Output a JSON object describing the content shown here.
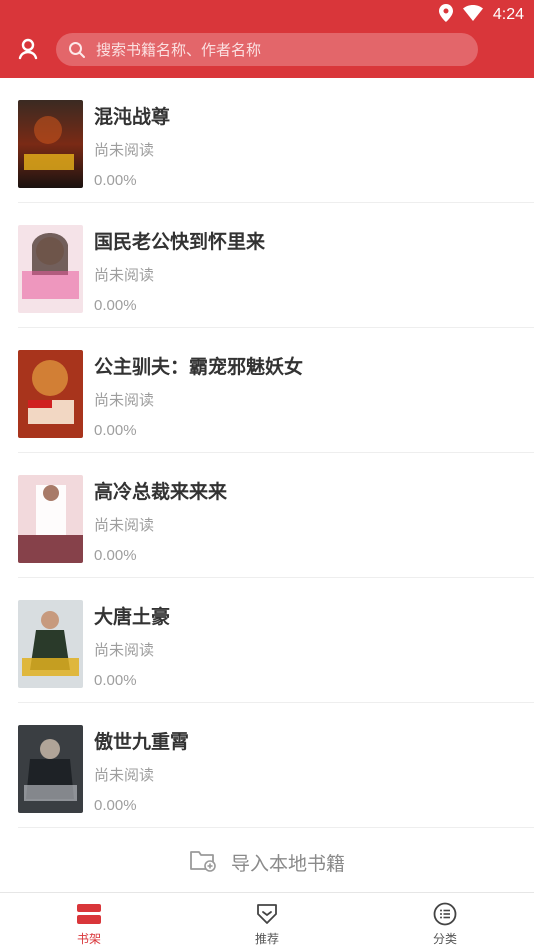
{
  "status_bar": {
    "time": "4:24"
  },
  "search": {
    "placeholder": "搜索书籍名称、作者名称"
  },
  "books": [
    {
      "title": "混沌战尊",
      "status": "尚未阅读",
      "progress": "0.00%"
    },
    {
      "title": "国民老公快到怀里来",
      "status": "尚未阅读",
      "progress": "0.00%"
    },
    {
      "title": "公主驯夫：霸宠邪魅妖女",
      "status": "尚未阅读",
      "progress": "0.00%"
    },
    {
      "title": "高冷总裁来来来",
      "status": "尚未阅读",
      "progress": "0.00%"
    },
    {
      "title": "大唐土豪",
      "status": "尚未阅读",
      "progress": "0.00%"
    },
    {
      "title": "傲世九重霄",
      "status": "尚未阅读",
      "progress": "0.00%"
    }
  ],
  "import": {
    "label": "导入本地书籍"
  },
  "tabs": [
    {
      "label": "书架",
      "icon": "bookshelf-icon",
      "active": true
    },
    {
      "label": "推荐",
      "icon": "recommend-icon",
      "active": false
    },
    {
      "label": "分类",
      "icon": "category-icon",
      "active": false
    }
  ],
  "colors": {
    "brand": "#d9363a",
    "text": "#333333",
    "muted": "#9e9e9e"
  }
}
